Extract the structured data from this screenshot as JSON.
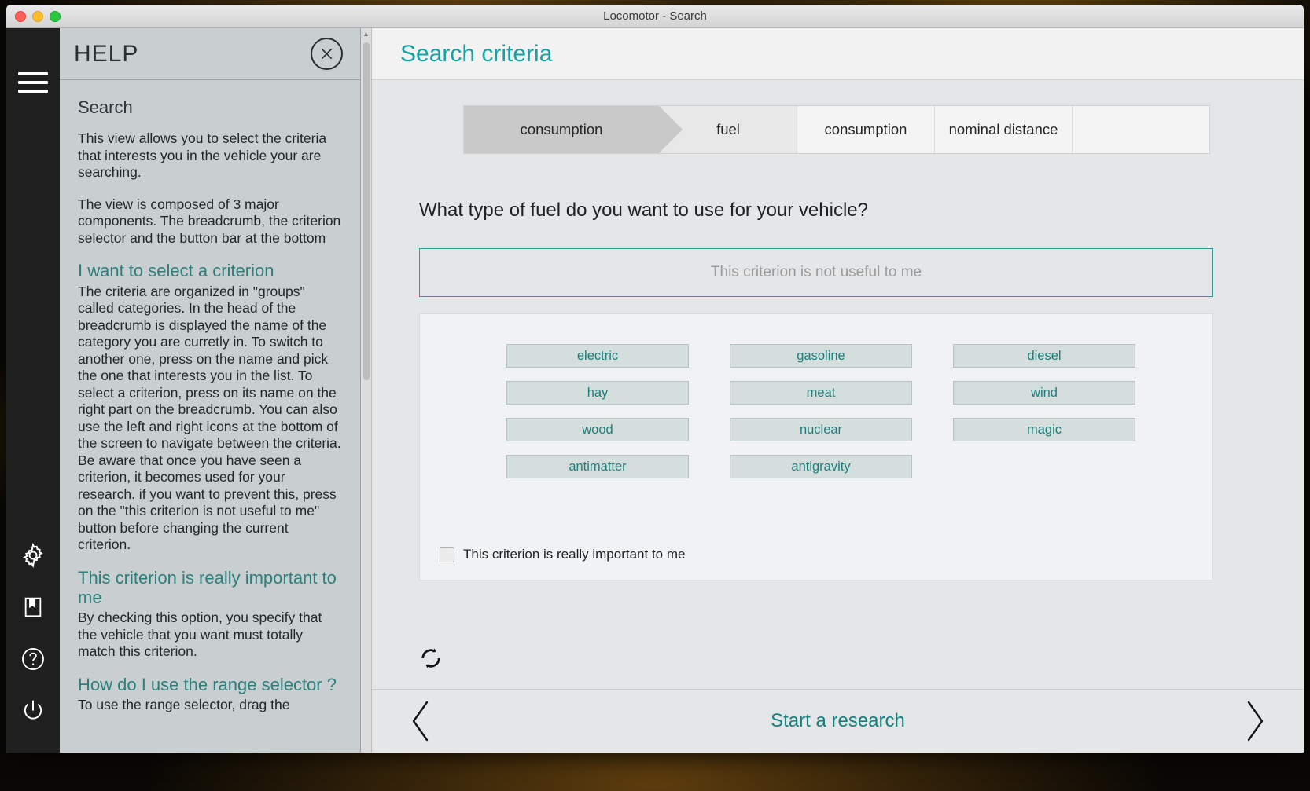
{
  "window": {
    "title": "Locomotor - Search"
  },
  "rail": {
    "items": [
      {
        "name": "menu",
        "icon": "hamburger-menu-icon"
      },
      {
        "name": "settings",
        "icon": "gear-icon"
      },
      {
        "name": "bookmarks",
        "icon": "book-icon"
      },
      {
        "name": "help",
        "icon": "question-mark-circle-icon"
      },
      {
        "name": "power",
        "icon": "power-icon"
      }
    ]
  },
  "help": {
    "title": "HELP",
    "close_label": "close-icon",
    "sections": [
      {
        "heading": "Search",
        "heading_color": "dark",
        "paragraphs": [
          "This view allows you to select the criteria that interests you in the vehicle your are searching.",
          "The view is composed of 3 major components. The breadcrumb, the criterion selector and the button bar at the bottom"
        ]
      },
      {
        "heading": "I want to select a criterion",
        "heading_color": "teal",
        "paragraphs": [
          "The criteria are organized in \"groups\" called categories. In the head of the breadcrumb is displayed the name of the category you are curretly in. To switch to another one, press on the name and pick the one that interests you in the list. To select a criterion, press on its name on the right part on the breadcrumb. You can also use the left and right icons at the bottom of the screen to navigate between the criteria. Be aware that once you have seen a criterion, it becomes used for your research. if you want to prevent this, press on the \"this criterion is not useful to me\" button before changing the current criterion."
        ]
      },
      {
        "heading": "This criterion is really important to me",
        "heading_color": "teal",
        "paragraphs": [
          "By checking this option, you specify that the vehicle that you want must totally match this criterion."
        ]
      },
      {
        "heading": "How do I use the range selector ?",
        "heading_color": "teal",
        "paragraphs": [
          "To use the range selector, drag the"
        ]
      }
    ]
  },
  "main": {
    "title": "Search criteria",
    "breadcrumb": {
      "head": "consumption",
      "crumbs": [
        "fuel",
        "consumption",
        "nominal distance",
        ""
      ]
    },
    "question": "What type of fuel do you want to use for your vehicle?",
    "not_useful_label": "This criterion is not useful to me",
    "options": [
      "electric",
      "gasoline",
      "diesel",
      "hay",
      "meat",
      "wind",
      "wood",
      "nuclear",
      "magic",
      "antimatter",
      "antigravity",
      ""
    ],
    "important_checkbox": {
      "label": "This criterion is really important to me",
      "checked": false
    },
    "reset_icon": "refresh-icon"
  },
  "bottombar": {
    "prev_icon": "chevron-left-icon",
    "start_label": "Start a research",
    "next_icon": "chevron-right-icon"
  },
  "colors": {
    "accent_teal": "#17a2a2",
    "option_teal": "#1c7f7b",
    "heading_teal": "#2d7f7c",
    "rail_dark": "#201f1f",
    "help_bg": "#c9ced1"
  }
}
